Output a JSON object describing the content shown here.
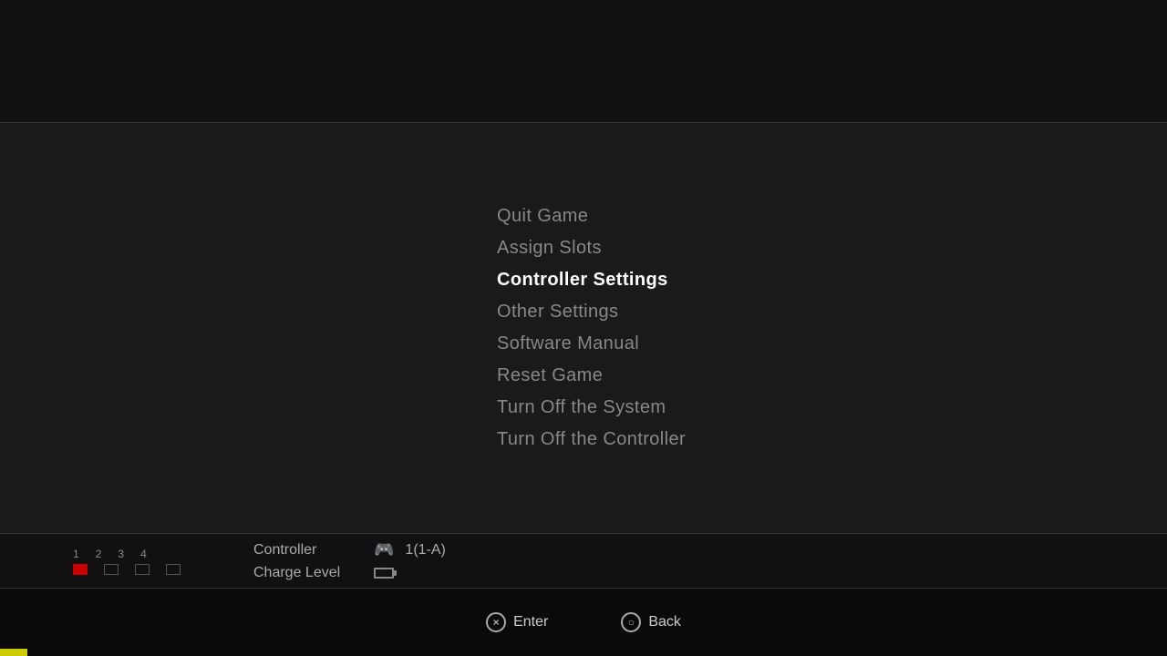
{
  "top_section": {
    "height": 135
  },
  "menu": {
    "items": [
      {
        "id": "quit-game",
        "label": "Quit Game",
        "active": false
      },
      {
        "id": "assign-slots",
        "label": "Assign Slots",
        "active": false
      },
      {
        "id": "controller-settings",
        "label": "Controller Settings",
        "active": true
      },
      {
        "id": "other-settings",
        "label": "Other Settings",
        "active": false
      },
      {
        "id": "software-manual",
        "label": "Software Manual",
        "active": false
      },
      {
        "id": "reset-game",
        "label": "Reset Game",
        "active": false
      },
      {
        "id": "turn-off-system",
        "label": "Turn Off the System",
        "active": false
      },
      {
        "id": "turn-off-controller",
        "label": "Turn Off the Controller",
        "active": false
      }
    ]
  },
  "bottom_bar": {
    "slots": {
      "numbers": [
        "1",
        "2",
        "3",
        "4"
      ],
      "active_slot": 0
    },
    "controller_label": "Controller",
    "controller_value": "1(1-A)",
    "charge_label": "Charge Level"
  },
  "footer": {
    "actions": [
      {
        "id": "enter",
        "button": "×",
        "label": "Enter"
      },
      {
        "id": "back",
        "button": "○",
        "label": "Back"
      }
    ]
  }
}
